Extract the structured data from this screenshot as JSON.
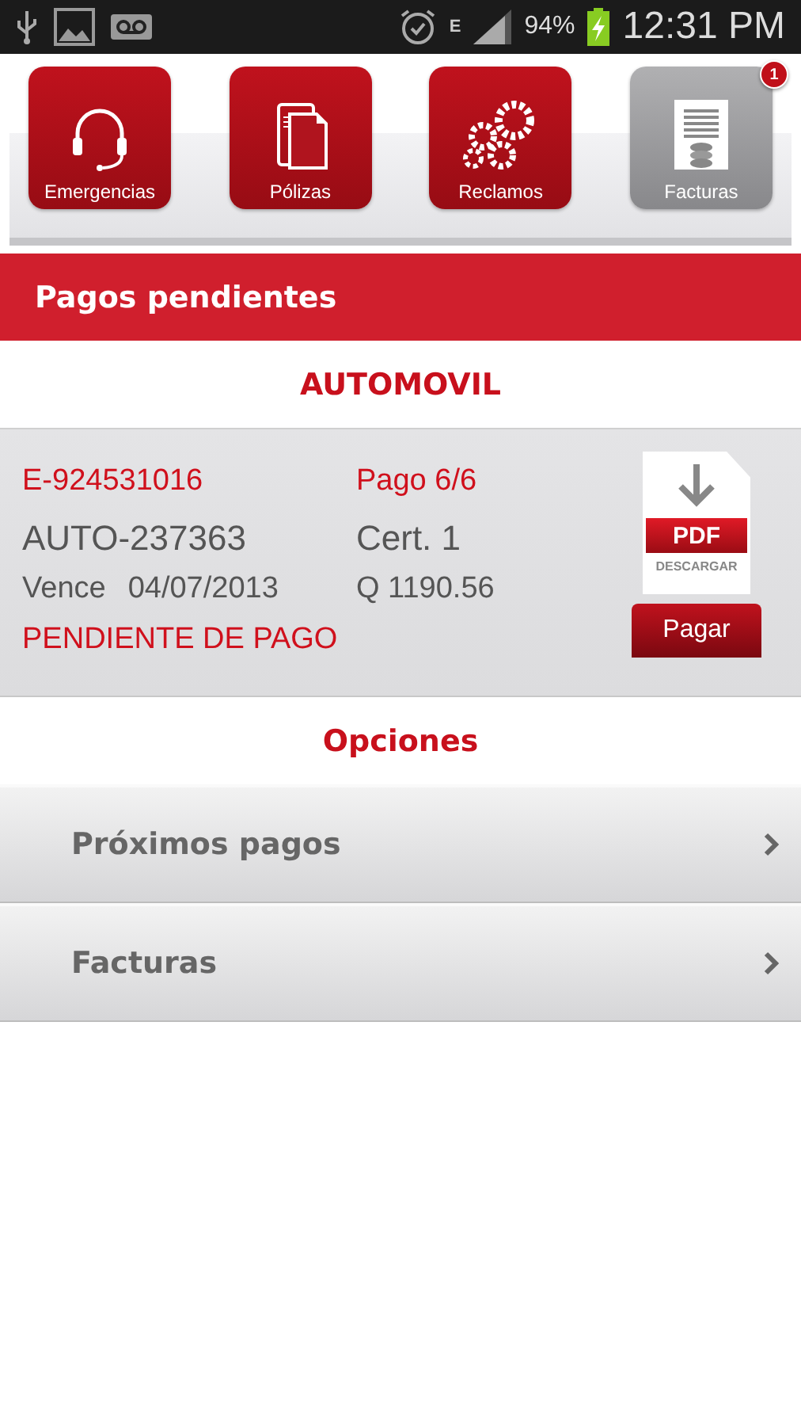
{
  "status_bar": {
    "battery": "94%",
    "time": "12:31 PM",
    "network": "E"
  },
  "tiles": [
    {
      "label": "Emergencias",
      "kind": "headset",
      "selected": false
    },
    {
      "label": "Pólizas",
      "kind": "documents",
      "selected": false
    },
    {
      "label": "Reclamos",
      "kind": "gears",
      "selected": false
    },
    {
      "label": "Facturas",
      "kind": "invoice",
      "selected": true,
      "badge": "1"
    }
  ],
  "header": {
    "title": "Pagos pendientes"
  },
  "section": {
    "title": "AUTOMOVIL"
  },
  "payment": {
    "policy": "E-924531016",
    "vehicle": "AUTO-237363",
    "due_label": "Vence",
    "due_date": "04/07/2013",
    "status": "PENDIENTE DE PAGO",
    "installment": "Pago 6/6",
    "certificate": "Cert. 1",
    "amount": "Q 1190.56",
    "pdf_label": "PDF",
    "pdf_caption": "DESCARGAR",
    "pay_button": "Pagar"
  },
  "options": {
    "title": "Opciones",
    "items": [
      {
        "label": "Próximos pagos"
      },
      {
        "label": "Facturas"
      }
    ]
  }
}
